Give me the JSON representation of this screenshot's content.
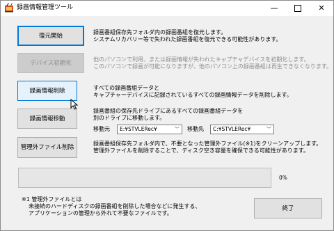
{
  "window": {
    "title": "録画情報管理ツール",
    "icon": "app-icon"
  },
  "controls": {
    "minimize": "—",
    "maximize": "□",
    "close": "✕"
  },
  "rows": [
    {
      "button": "復元開始",
      "enabled": true,
      "description": [
        "録画番組保存先フォルダ内の録画番組を復元します。",
        "システムリカバリー等で失われた録画番組を復元できる可能性があります。"
      ]
    },
    {
      "button": "デバイス初期化",
      "enabled": false,
      "description": [
        "他のパソコンで利用、または録画情報が失われたキャプチャデバイスを初期化します。",
        "このパソコンで録画が可能になりますが、他のパソコン上の録画番組は再生できなくなります。"
      ]
    },
    {
      "button": "録画情報削除",
      "enabled": true,
      "description": [
        "すべての録画番組データと",
        "キャプチャーデバイスに記録されているすべての録画情報データを削除します。"
      ]
    },
    {
      "button": "録画情報移動",
      "enabled": true,
      "description": [
        "録画番組の保存先ドライブにあるすべての録画番組データを",
        "別のドライブに移動します。"
      ]
    },
    {
      "button": "管理外ファイル削除",
      "enabled": true,
      "description": [
        "録画番組保存先フォルダ内で、不要となった管理外ファイル(※1)をクリーンアップします。",
        "管理外ファイルを削除することで、ディスク空き容量を確保できる可能性があります。"
      ]
    }
  ],
  "move": {
    "source_label": "移動元",
    "source_value": "E:¥STVLERec¥",
    "dest_label": "移動先",
    "dest_value": "C:¥STVLERec¥"
  },
  "progress": {
    "percent_text": "0%",
    "value": 0
  },
  "footnote": [
    "※1 管理外ファイルとは",
    "未接続のハードディスクの録画番組を削除した場合などに発生する、",
    "アプリケーションの管理から外れて不要なファイルです。"
  ],
  "exit_button": "終了",
  "colors": {
    "focus_border": "#0078d7",
    "progress_fill": "#06b025"
  }
}
